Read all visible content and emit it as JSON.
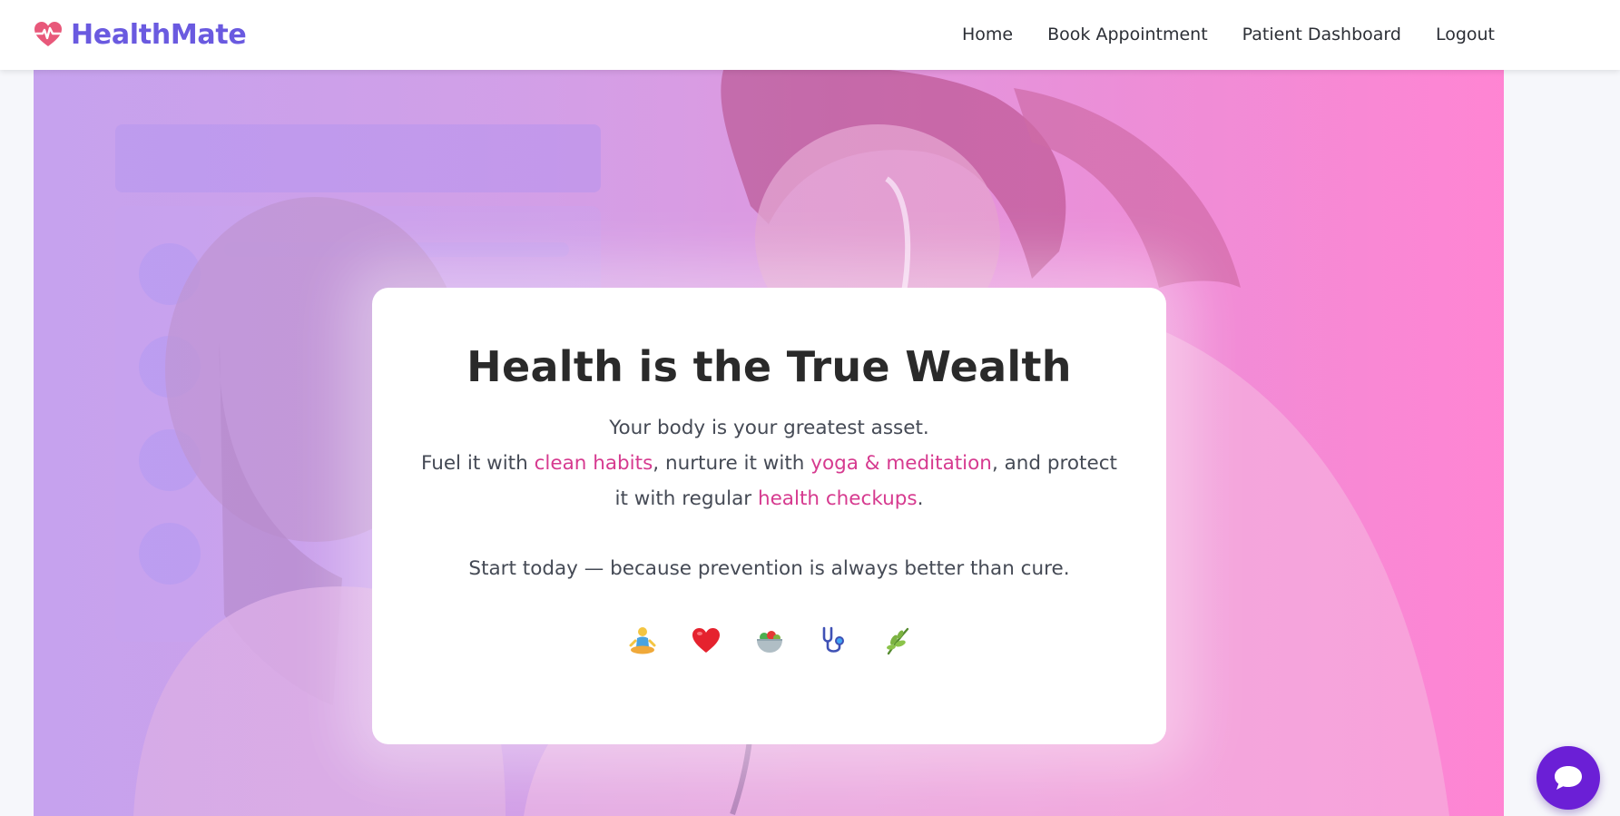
{
  "brand": {
    "name": "HealthMate",
    "icon": "heart-pulse-icon",
    "color": "#6a5ae0",
    "icon_color": "#e8587a"
  },
  "nav": {
    "items": [
      {
        "label": "Home"
      },
      {
        "label": "Book Appointment"
      },
      {
        "label": "Patient Dashboard"
      },
      {
        "label": "Logout"
      }
    ]
  },
  "hero": {
    "background_icon": "doctor-with-child-photo",
    "card": {
      "title": "Health is the True Wealth",
      "line1": "Your body is your greatest asset.",
      "line2_part1": "Fuel it with ",
      "highlight1": "clean habits",
      "line2_part2": ", nurture it with ",
      "highlight2": "yoga & meditation",
      "line2_part3": ", and protect it with regular ",
      "highlight3": "health checkups",
      "line2_part4": ".",
      "cta": "Start today — because prevention is always better than cure.",
      "highlight_color": "#d63a8f",
      "emojis": [
        "meditation-icon",
        "heart-icon",
        "salad-bowl-icon",
        "stethoscope-icon",
        "herb-icon"
      ]
    }
  },
  "chat": {
    "icon": "chat-bubble-icon",
    "color": "#6b1fd6"
  }
}
